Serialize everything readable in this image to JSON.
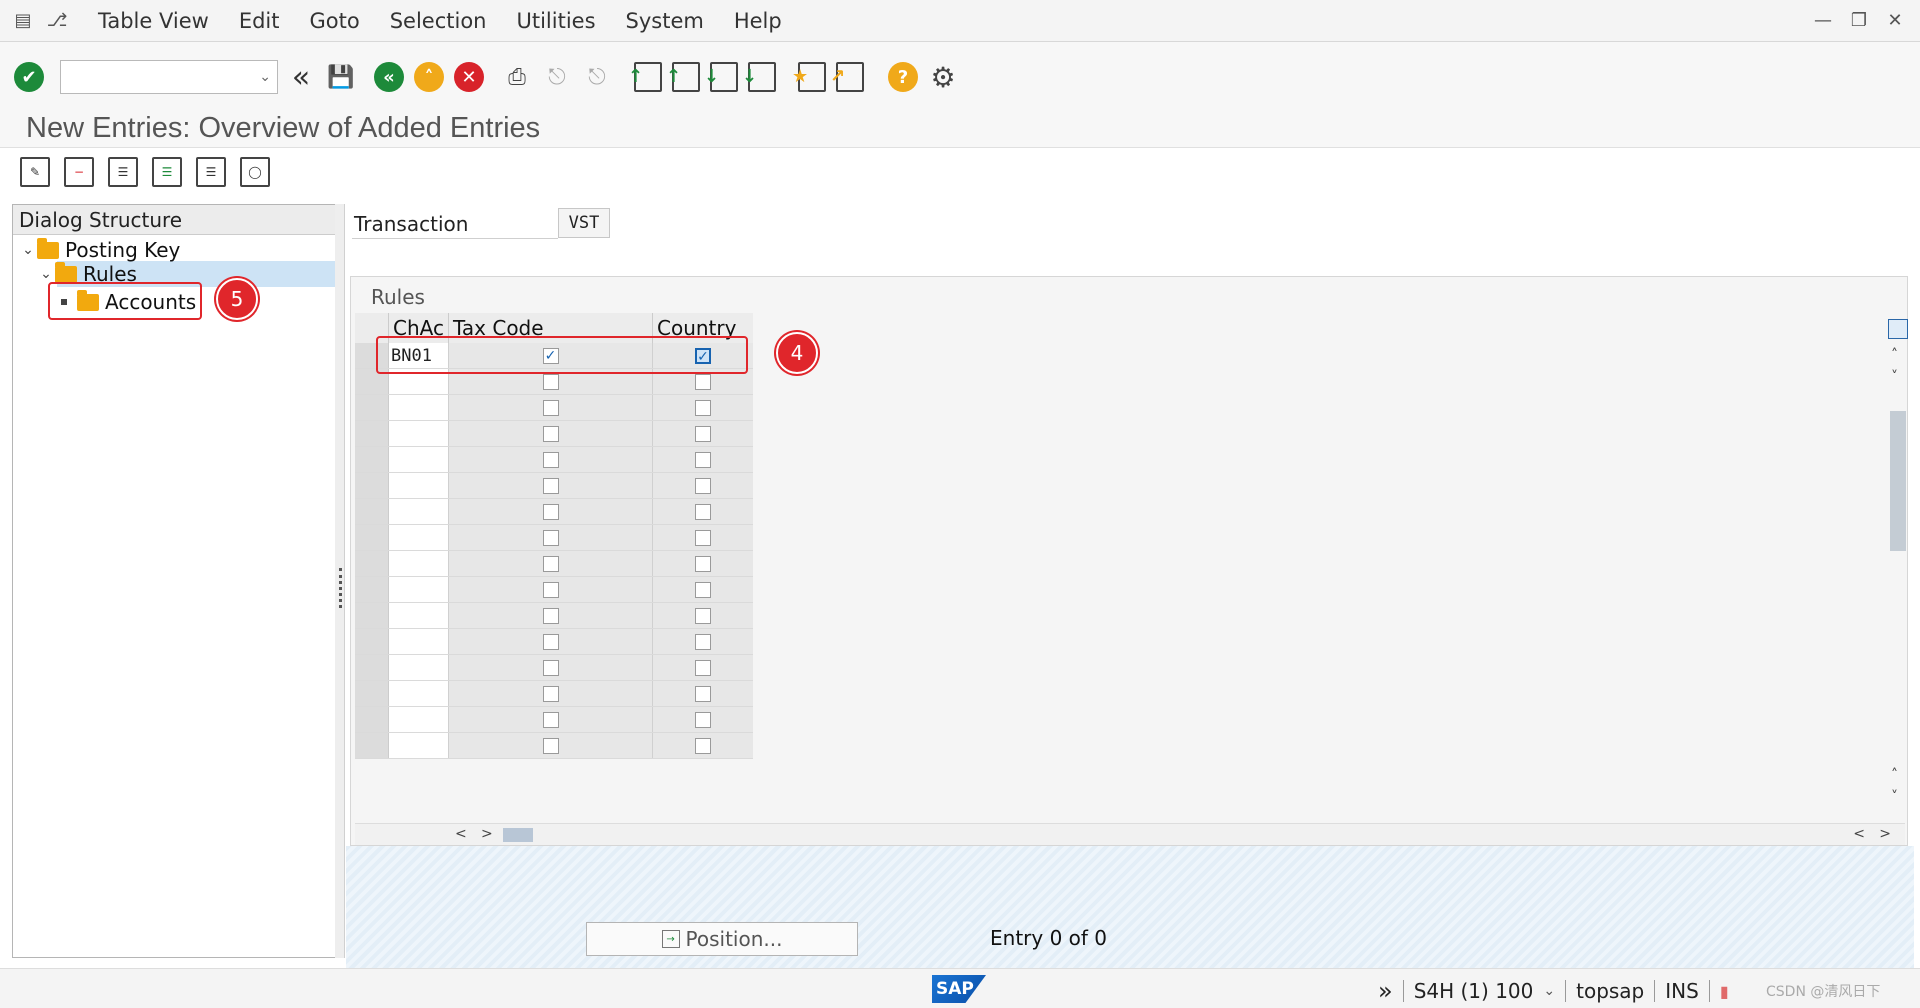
{
  "menu": {
    "items": [
      "Table View",
      "Edit",
      "Goto",
      "Selection",
      "Utilities",
      "System",
      "Help"
    ]
  },
  "window_controls": [
    "minimize",
    "restore",
    "close"
  ],
  "toolbar": {
    "command_field_value": "",
    "icons": [
      "check-icon",
      "command-field",
      "back-double-icon",
      "save-icon",
      "back-icon",
      "exit-icon",
      "cancel-icon",
      "print-icon",
      "find-icon",
      "find-next-icon",
      "first-page-icon",
      "previous-page-icon",
      "next-page-icon",
      "last-page-icon",
      "new-session-icon",
      "shortcut-icon",
      "help-icon",
      "settings-icon"
    ]
  },
  "page": {
    "title": "New Entries: Overview of Added Entries"
  },
  "app_toolbar": {
    "icons": [
      "change-display-icon",
      "delete-icon",
      "select-all-icon",
      "select-block-icon",
      "deselect-all-icon",
      "print-standard-list-icon"
    ]
  },
  "tree": {
    "header": "Dialog Structure",
    "nodes": [
      {
        "label": "Posting Key",
        "level": 0,
        "expanded": true
      },
      {
        "label": "Rules",
        "level": 1,
        "expanded": true,
        "selected": true
      },
      {
        "label": "Accounts",
        "level": 2,
        "expanded": false
      }
    ]
  },
  "header_fields": {
    "transaction_label": "Transaction",
    "transaction_value": "VST"
  },
  "rules": {
    "title": "Rules",
    "columns": [
      "ChAc",
      "Tax Code",
      "Country"
    ],
    "rows": [
      {
        "chac": "BN01",
        "tax_code": true,
        "country": true
      },
      {
        "chac": "",
        "tax_code": false,
        "country": false
      },
      {
        "chac": "",
        "tax_code": false,
        "country": false
      },
      {
        "chac": "",
        "tax_code": false,
        "country": false
      },
      {
        "chac": "",
        "tax_code": false,
        "country": false
      },
      {
        "chac": "",
        "tax_code": false,
        "country": false
      },
      {
        "chac": "",
        "tax_code": false,
        "country": false
      },
      {
        "chac": "",
        "tax_code": false,
        "country": false
      },
      {
        "chac": "",
        "tax_code": false,
        "country": false
      },
      {
        "chac": "",
        "tax_code": false,
        "country": false
      },
      {
        "chac": "",
        "tax_code": false,
        "country": false
      },
      {
        "chac": "",
        "tax_code": false,
        "country": false
      },
      {
        "chac": "",
        "tax_code": false,
        "country": false
      },
      {
        "chac": "",
        "tax_code": false,
        "country": false
      },
      {
        "chac": "",
        "tax_code": false,
        "country": false
      },
      {
        "chac": "",
        "tax_code": false,
        "country": false
      }
    ]
  },
  "footer": {
    "position_button": "Position...",
    "entry_text": "Entry 0 of 0"
  },
  "annotations": {
    "badge_rules_row": "4",
    "badge_accounts": "5",
    "color": "#e0262b"
  },
  "statusbar": {
    "system": "S4H (1) 100",
    "server": "topsap",
    "mode": "INS",
    "watermark": "CSDN @清风日下"
  },
  "colors": {
    "accent": "#1763b0",
    "folder": "#f2a90e",
    "ok_green": "#1d8a3a",
    "cancel_red": "#d8232a",
    "help_yellow": "#f0a91a"
  }
}
